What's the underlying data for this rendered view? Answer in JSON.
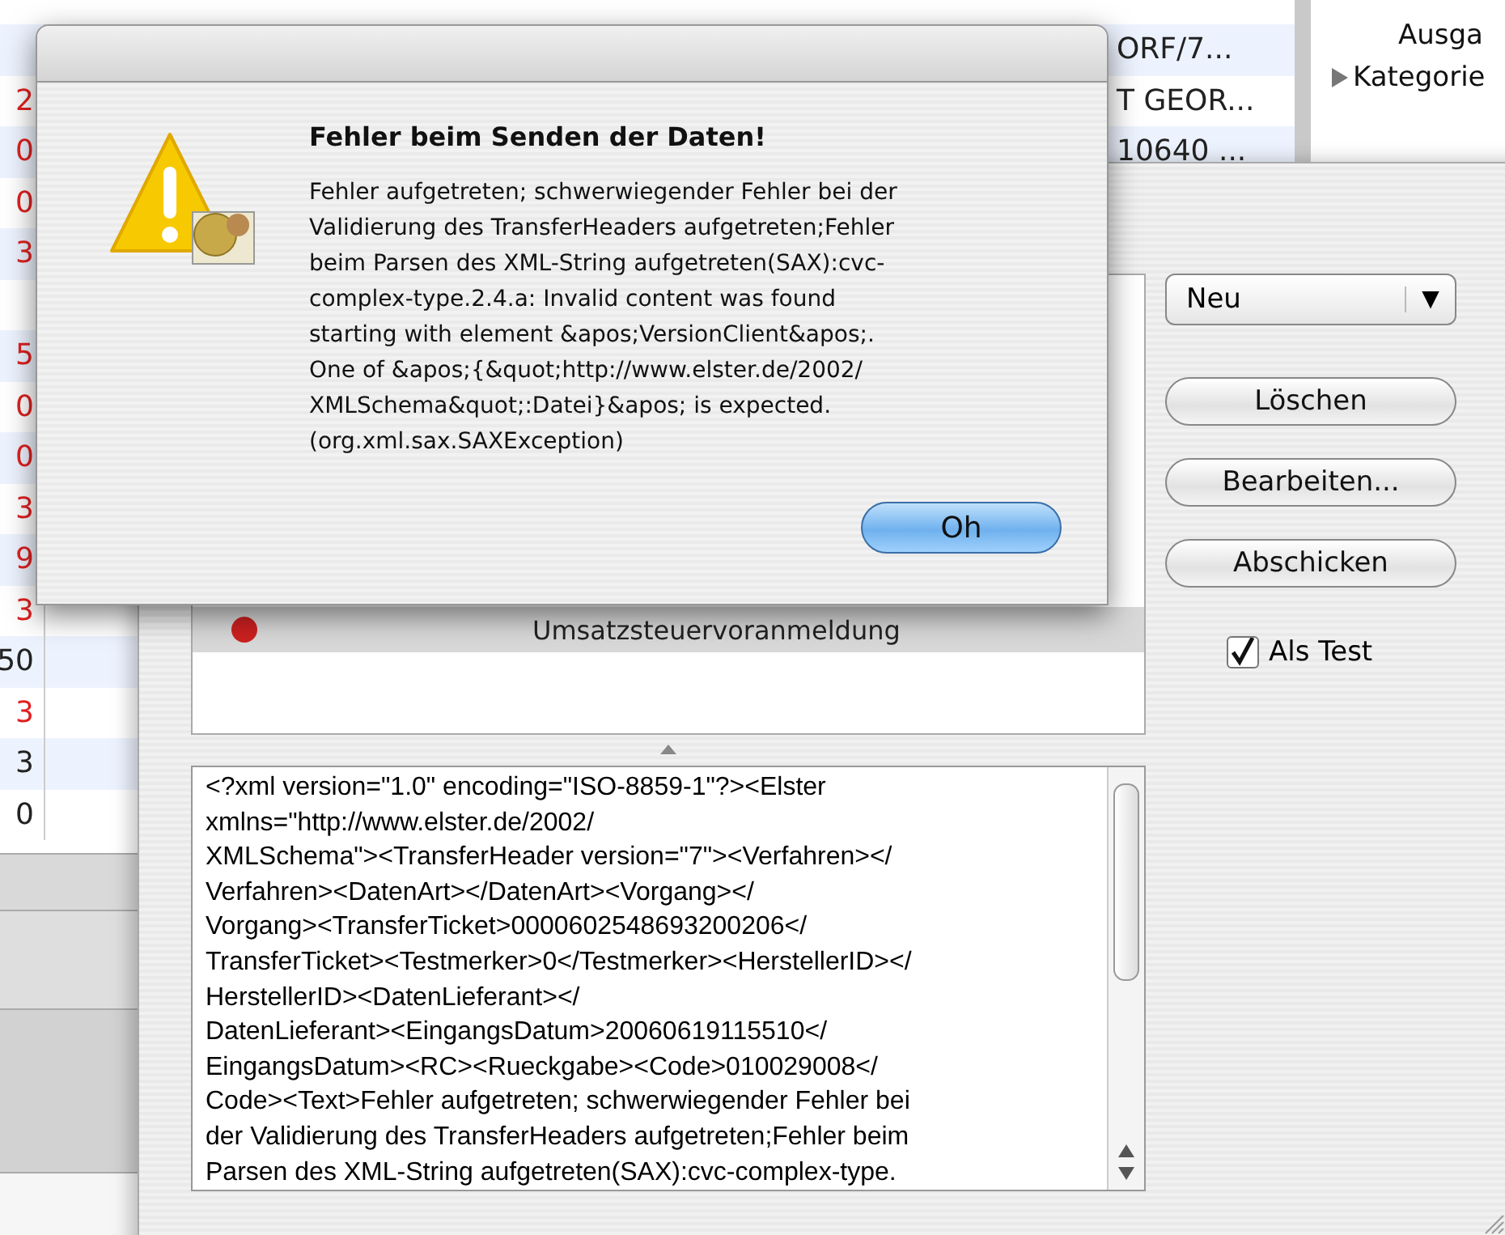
{
  "background_window": {
    "rows": [
      {
        "ref": "ORF/7..."
      },
      {
        "amount": "2",
        "color": "#e02020",
        "ref": "T GEOR..."
      },
      {
        "amount": "0",
        "color": "#e02020",
        "ref": "10640 ..."
      },
      {
        "amount": "0",
        "color": "#e02020"
      },
      {
        "amount": "3",
        "color": "#e02020"
      },
      {},
      {
        "amount": "5",
        "color": "#e02020"
      },
      {
        "amount": "0",
        "color": "#e02020"
      },
      {
        "amount": "0",
        "color": "#e02020"
      },
      {
        "amount": "3",
        "color": "#e02020"
      },
      {
        "amount": "9",
        "color": "#e02020"
      },
      {
        "amount": "3",
        "color": "#e02020"
      },
      {
        "amount": "50",
        "color": "#222222"
      },
      {
        "amount": "3",
        "color": "#e02020"
      },
      {
        "amount": "3",
        "color": "#222222"
      },
      {
        "amount": "0",
        "color": "#222222"
      }
    ],
    "sidebar": {
      "heading": "Ausga",
      "items": [
        {
          "label": "Kategorie",
          "expanded": false
        }
      ]
    }
  },
  "panel": {
    "list_items": [
      {
        "label": "Umsatzsteuervoranmeldung",
        "selected": true,
        "color": "#cc2020"
      }
    ],
    "xml_lines": [
      "<?xml version=\"1.0\" encoding=\"ISO-8859-1\"?><Elster",
      "xmlns=\"http://www.elster.de/2002/",
      "XMLSchema\"><TransferHeader version=\"7\"><Verfahren></",
      "Verfahren><DatenArt></DatenArt><Vorgang></",
      "Vorgang><TransferTicket>0000602548693200206</",
      "TransferTicket><Testmerker>0</Testmerker><HerstellerID></",
      "HerstellerID><DatenLieferant></",
      "DatenLieferant><EingangsDatum>20060619115510</",
      "EingangsDatum><RC><Rueckgabe><Code>010029008</",
      "Code><Text>Fehler aufgetreten; schwerwiegender Fehler bei",
      "der Validierung des TransferHeaders aufgetreten;Fehler beim",
      "Parsen des XML-String aufgetreten(SAX):cvc-complex-type."
    ],
    "popup": {
      "value": "Neu",
      "arrow": "▼"
    },
    "buttons": [
      "Löschen",
      "Bearbeiten...",
      "Abschicken"
    ],
    "checkbox": {
      "label": "Als Test",
      "checked": true
    }
  },
  "alert": {
    "title": "Fehler beim Senden der Daten!",
    "message_lines": [
      "Fehler aufgetreten; schwerwiegender Fehler bei der",
      "Validierung des TransferHeaders aufgetreten;Fehler",
      "beim Parsen des XML-String aufgetreten(SAX):cvc-",
      "complex-type.2.4.a: Invalid content was found",
      "starting with element &apos;VersionClient&apos;.",
      "One of &apos;{&quot;http://www.elster.de/2002/",
      "XMLSchema&quot;:Datei}&apos; is expected.",
      "(org.xml.sax.SAXException)"
    ],
    "button": "Oh"
  }
}
